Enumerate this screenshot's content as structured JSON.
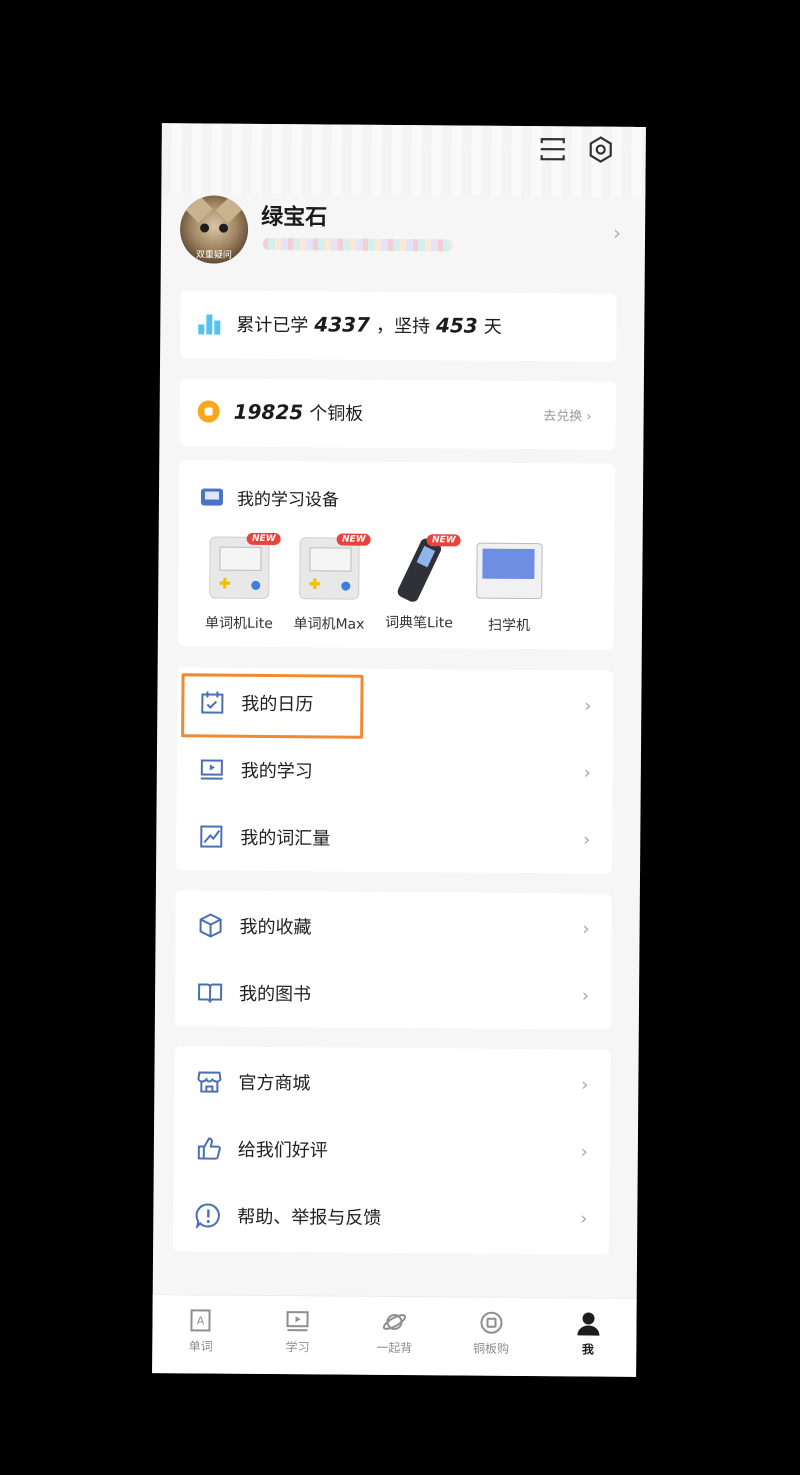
{
  "profile": {
    "name": "绿宝石",
    "avatar_caption": "双重疑问"
  },
  "stats": {
    "prefix": "累计已学",
    "learned": "4337",
    "mid": "，坚持",
    "days": "453",
    "suffix": "天"
  },
  "coins": {
    "amount": "19825",
    "unit": "个铜板",
    "redeem_label": "去兑换 ›"
  },
  "devices": {
    "title": "我的学习设备",
    "new_badge": "NEW",
    "items": [
      {
        "label": "单词机Lite",
        "is_new": true
      },
      {
        "label": "单词机Max",
        "is_new": true
      },
      {
        "label": "词典笔Lite",
        "is_new": true
      },
      {
        "label": "扫学机",
        "is_new": false
      }
    ]
  },
  "menu1": [
    "我的日历",
    "我的学习",
    "我的词汇量"
  ],
  "menu2": [
    "我的收藏",
    "我的图书"
  ],
  "menu3": [
    "官方商城",
    "给我们好评",
    "帮助、举报与反馈"
  ],
  "tabs": [
    {
      "label": "单词",
      "active": false
    },
    {
      "label": "学习",
      "active": false
    },
    {
      "label": "一起背",
      "active": false
    },
    {
      "label": "铜板购",
      "active": false
    },
    {
      "label": "我",
      "active": true
    }
  ],
  "colors": {
    "accent": "#4a6fb4",
    "highlight": "#f0892f",
    "coin": "#f7a81d",
    "new_badge": "#e8433c"
  }
}
